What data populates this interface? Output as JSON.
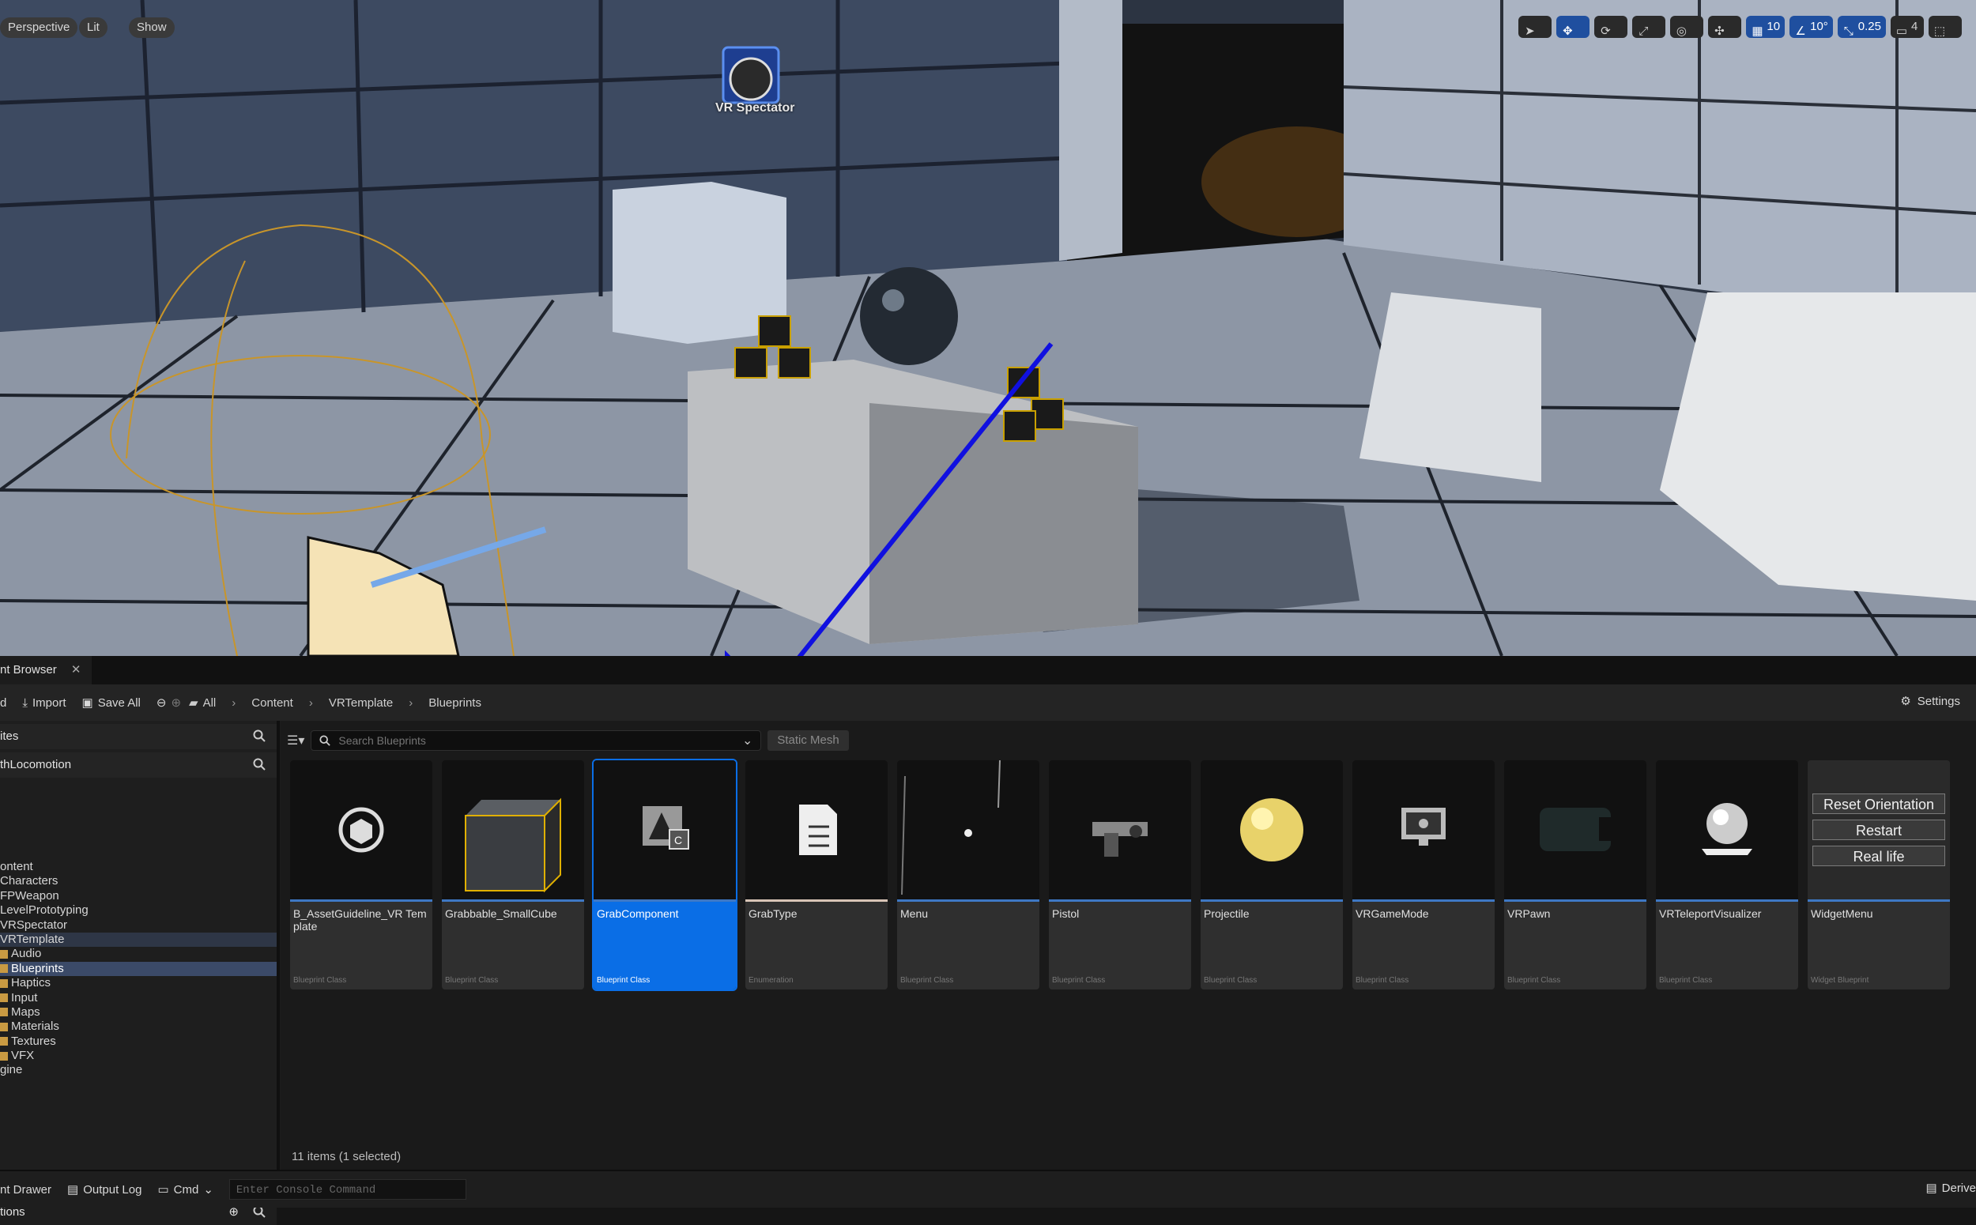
{
  "viewport": {
    "mode_buttons": [
      "Perspective",
      "Lit",
      "Show"
    ],
    "tools": {
      "grid_snap": "10",
      "rotation_snap": "10°",
      "scale_snap": "0.25",
      "camera_speed": "4"
    },
    "spectator_label": "VR Spectator",
    "annotation_arrow_color": "#1010e0"
  },
  "content_browser": {
    "tab_label": "nt Browser",
    "toolbar": {
      "add_label": "d",
      "import_label": "Import",
      "save_all_label": "Save All",
      "breadcrumbs": [
        "All",
        "Content",
        "VRTemplate",
        "Blueprints"
      ],
      "settings_label": "Settings"
    },
    "left_panel": {
      "favorites_label": "ites",
      "project_label": "thLocomotion",
      "collections_label": "tions",
      "tree": [
        {
          "label": "ontent",
          "folder": false,
          "state": ""
        },
        {
          "label": "Characters",
          "folder": false,
          "state": ""
        },
        {
          "label": "FPWeapon",
          "folder": false,
          "state": ""
        },
        {
          "label": "LevelPrototyping",
          "folder": false,
          "state": ""
        },
        {
          "label": "VRSpectator",
          "folder": false,
          "state": ""
        },
        {
          "label": "VRTemplate",
          "folder": false,
          "state": "hl"
        },
        {
          "label": "Audio",
          "folder": true,
          "state": ""
        },
        {
          "label": "Blueprints",
          "folder": true,
          "state": "sel"
        },
        {
          "label": "Haptics",
          "folder": true,
          "state": ""
        },
        {
          "label": "Input",
          "folder": true,
          "state": ""
        },
        {
          "label": "Maps",
          "folder": true,
          "state": ""
        },
        {
          "label": "Materials",
          "folder": true,
          "state": ""
        },
        {
          "label": "Textures",
          "folder": true,
          "state": ""
        },
        {
          "label": "VFX",
          "folder": true,
          "state": ""
        },
        {
          "label": "gine",
          "folder": false,
          "state": ""
        }
      ]
    },
    "search": {
      "placeholder": "Search Blueprints",
      "filter_chip": "Static Mesh"
    },
    "assets": [
      {
        "name": "B_AssetGuideline_VR Template",
        "type": "Blueprint Class",
        "icon": "cube-outline-icon"
      },
      {
        "name": "Grabbable_SmallCube",
        "type": "Blueprint Class",
        "icon": "small-cube-thumbnail"
      },
      {
        "name": "GrabComponent",
        "type": "Blueprint Class",
        "icon": "component-icon"
      },
      {
        "name": "GrabType",
        "type": "Enumeration",
        "icon": "enum-list-icon"
      },
      {
        "name": "Menu",
        "type": "Blueprint Class",
        "icon": "menu-thumbnail"
      },
      {
        "name": "Pistol",
        "type": "Blueprint Class",
        "icon": "pistol-thumbnail"
      },
      {
        "name": "Projectile",
        "type": "Blueprint Class",
        "icon": "yellow-sphere-thumbnail"
      },
      {
        "name": "VRGameMode",
        "type": "Blueprint Class",
        "icon": "game-mode-icon"
      },
      {
        "name": "VRPawn",
        "type": "Blueprint Class",
        "icon": "headset-thumbnail"
      },
      {
        "name": "VRTeleportVisualizer",
        "type": "Blueprint Class",
        "icon": "sphere-thumbnail"
      },
      {
        "name": "WidgetMenu",
        "type": "Widget Blueprint",
        "icon": "widget-menu-thumbnail"
      }
    ],
    "widget_menu_buttons": [
      "Reset Orientation",
      "Restart",
      "Real life"
    ],
    "selected_asset": "GrabComponent",
    "items_count": "11 items (1 selected)"
  },
  "bottom_bar": {
    "drawer_label": "nt Drawer",
    "output_log_label": "Output Log",
    "cmd_label": "Cmd",
    "console_placeholder": "Enter Console Command",
    "derived_label": "Derive"
  }
}
